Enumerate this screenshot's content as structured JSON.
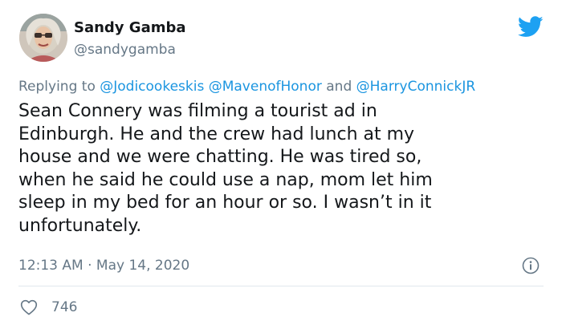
{
  "author": {
    "display_name": "Sandy Gamba",
    "handle": "@sandygamba",
    "avatar_icon": "profile-photo"
  },
  "brand": {
    "icon": "twitter-bird-icon",
    "color": "#1da1f2"
  },
  "reply": {
    "prefix": "Replying to",
    "mention_1": "@Jodicookeskis",
    "mention_2": "@MavenofHonor",
    "joiner": "and",
    "mention_3": "@HarryConnickJR"
  },
  "tweet": {
    "text": "Sean Connery was filming a tourist ad in\nEdinburgh. He and the crew had lunch at my\nhouse and we were chatting. He was tired so,\nwhen he said he could use a nap, mom let him\nsleep in my bed for an hour or so. I wasn’t in it\nunfortunately.",
    "timestamp": "12:13 AM · May 14, 2020"
  },
  "stats": {
    "likes": "746"
  },
  "colors": {
    "text": "#14171a",
    "secondary": "#657786",
    "link": "#1b95e0",
    "divider": "#e1e8ed"
  }
}
